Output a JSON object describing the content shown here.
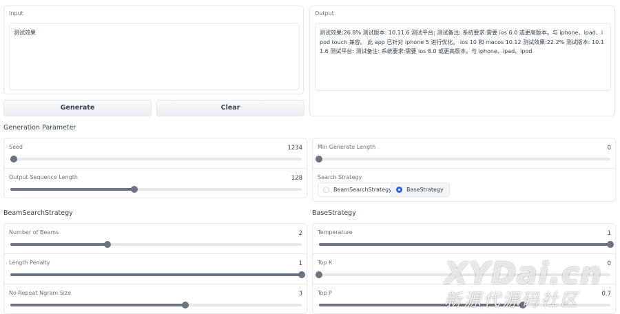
{
  "input": {
    "label": "Input",
    "value": "测试效果"
  },
  "output": {
    "label": "Output",
    "value": "测试效果:26.8% 测试版本: 10.11.6 测试平台: 测试备注: 系统要求:需要 ios 6.0 或更高版本。与 iphone、ipad、ipod touch 兼容。 此 app 已针对 iphone 5 进行优化。 ios 10 和 macos 10.12 测试效果:22.2% 测试版本: 10.11.6 测试平台: 测试备注: 系统要求:需要 ios 8.0 或更高版本。与 iphone、ipad、ipod"
  },
  "buttons": {
    "generate": "Generate",
    "clear": "Clear"
  },
  "generation": {
    "title": "Generation Parameter",
    "seed": {
      "label": "Seed",
      "value": "1234",
      "min": 0,
      "max": 100000
    },
    "output_len": {
      "label": "Output Sequence Length",
      "value": "128",
      "min": 1,
      "max": 300
    },
    "min_len": {
      "label": "Min Generate Length",
      "value": "0",
      "min": 0,
      "max": 100
    },
    "strategy": {
      "label": "Search Strategy",
      "options": [
        "BeamSearchStrategy",
        "BaseStrategy"
      ],
      "selected": "BaseStrategy"
    }
  },
  "beam": {
    "title": "BeamSearchStrategy",
    "num_beams": {
      "label": "Number of Beams",
      "value": "2",
      "min": 1,
      "max": 4
    },
    "length_penalty": {
      "label": "Length Penalty",
      "value": "1",
      "min": 0,
      "max": 1
    },
    "no_repeat": {
      "label": "No Repeat Ngram Size",
      "value": "3",
      "min": 0,
      "max": 5
    }
  },
  "base": {
    "title": "BaseStrategy",
    "temperature": {
      "label": "Temperature",
      "value": "1",
      "min": 0,
      "max": 1
    },
    "top_k": {
      "label": "Top K",
      "value": "0",
      "min": 0,
      "max": 40
    },
    "top_p": {
      "label": "Top P",
      "value": "0.7",
      "min": 0,
      "max": 1
    }
  },
  "watermark": {
    "line1": "XYDai.cn",
    "line2": "新源代源码社区"
  }
}
